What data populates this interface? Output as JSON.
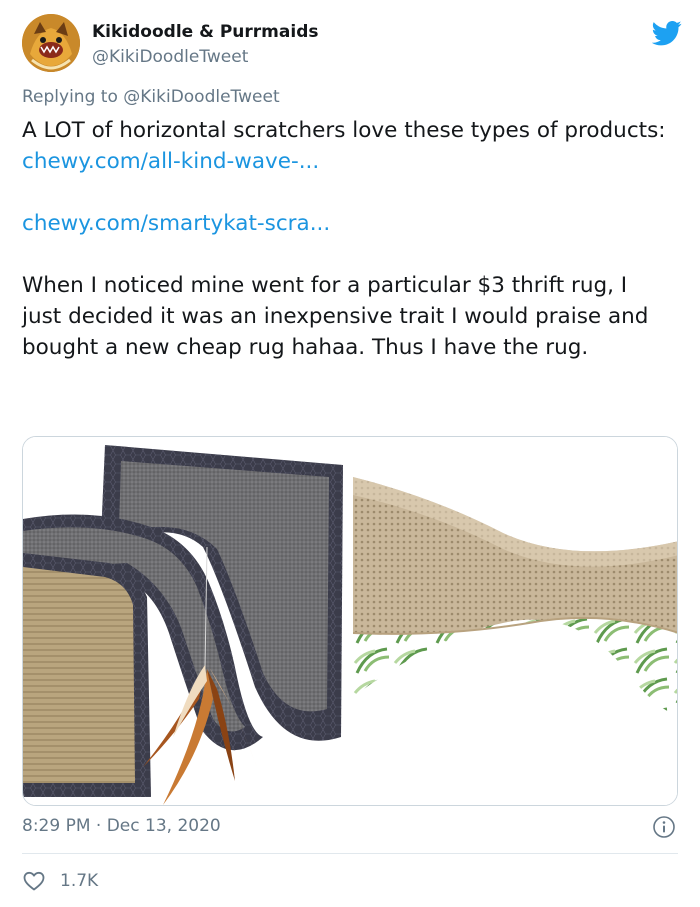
{
  "author": {
    "name": "Kikidoodle & Purrmaids",
    "handle": "@KikiDoodleTweet",
    "avatar_icon": "cat-avatar-icon"
  },
  "brand_icon": "twitter-bird-icon",
  "reply": {
    "prefix": "Replying to ",
    "mention": "@KikiDoodleTweet"
  },
  "tweet": {
    "intro": "A LOT of horizontal scratchers love these types of products:",
    "link1": "chewy.com/all-kind-wave-...",
    "link2": "chewy.com/smartykat-scra...",
    "body": "When I noticed mine went for a particular $3 thrift rug, I just decided it was an inexpensive trait I would praise and bought a new cheap rug hahaa. Thus I have the rug."
  },
  "media": {
    "left_image": "wave-sisal-cat-scratcher-with-feather-toy",
    "right_image": "cardboard-wave-cat-scratcher-with-leaf-print"
  },
  "meta": {
    "timestamp": "8:29 PM · Dec 13, 2020"
  },
  "engagement": {
    "likes": "1.7K"
  },
  "colors": {
    "link": "#1b95e0",
    "secondary_text": "#657786",
    "twitter_blue": "#1da1f2"
  }
}
